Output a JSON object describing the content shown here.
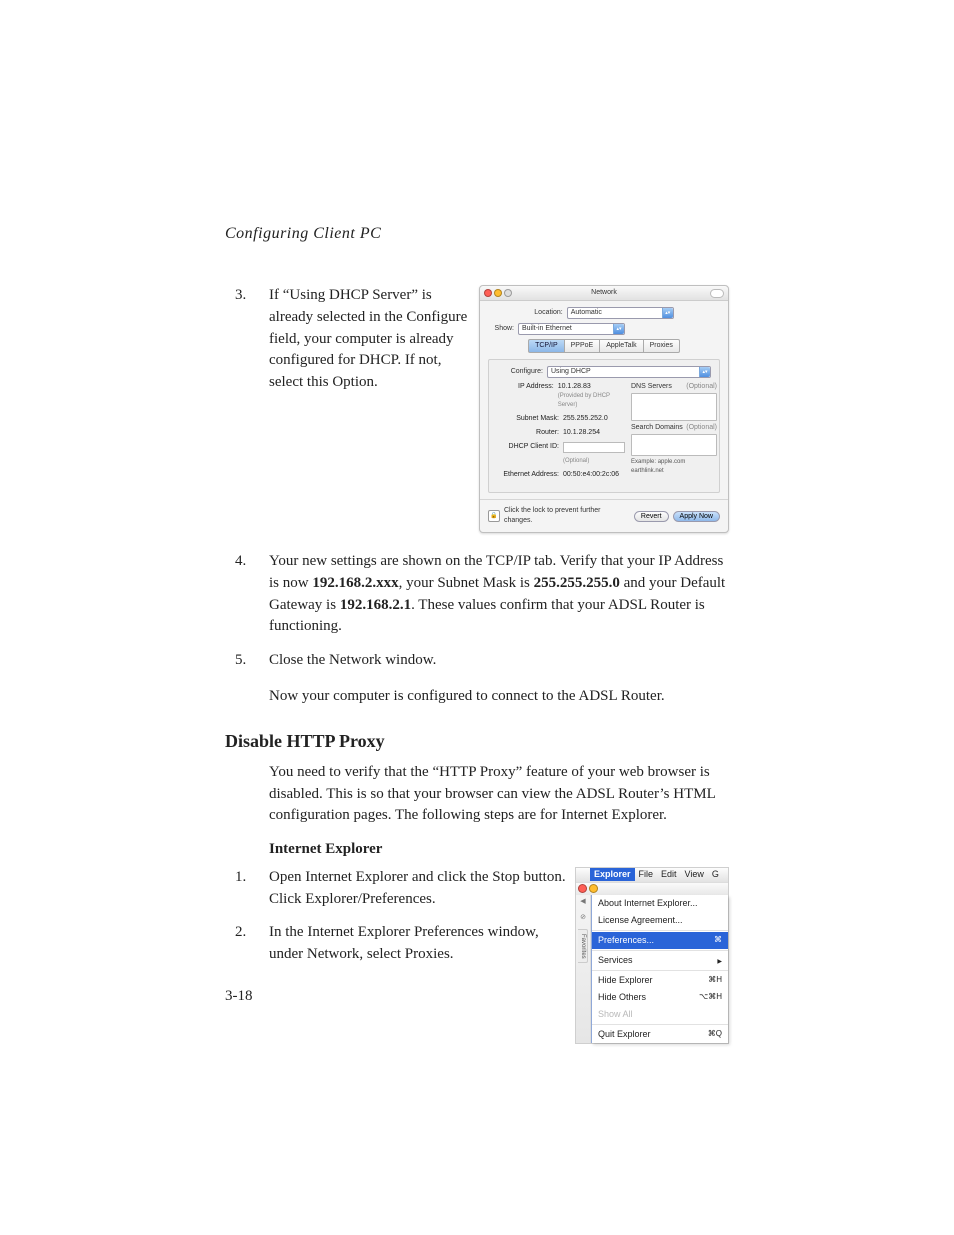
{
  "running_head": "Configuring Client PC",
  "steps_a": [
    {
      "n": "3.",
      "text": "If “Using DHCP Server” is already selected in the Configure field, your computer is already configured for DHCP. If not, select this Option."
    }
  ],
  "steps_b": [
    {
      "n": "4.",
      "pre": "Your new settings are shown on the TCP/IP tab. Verify that your IP Address is now ",
      "b1": "192.168.2.xxx",
      "mid1": ", your Subnet Mask is ",
      "b2": "255.255.255.0",
      "mid2": " and your Default Gateway is ",
      "b3": "192.168.2.1",
      "post": ". These values confirm that your ADSL Router is functioning."
    },
    {
      "n": "5.",
      "text": "Close the Network window."
    }
  ],
  "para1": "Now your computer is configured to connect to the ADSL Router.",
  "h2": "Disable HTTP Proxy",
  "para2": "You need to verify that the “HTTP Proxy” feature of your web browser is disabled. This is so that your browser can view the ADSL Router’s HTML configuration pages. The following steps are for Internet Explorer.",
  "h3": "Internet Explorer",
  "steps_c": [
    {
      "n": "1.",
      "text": "Open Internet Explorer and click the Stop button. Click Explorer/Preferences."
    },
    {
      "n": "2.",
      "text": "In the Internet Explorer Preferences window, under Network, select Proxies."
    }
  ],
  "page_number": "3-18",
  "network_panel": {
    "title": "Network",
    "location_label": "Location:",
    "location_value": "Automatic",
    "show_label": "Show:",
    "show_value": "Built-in Ethernet",
    "tabs": [
      "TCP/IP",
      "PPPoE",
      "AppleTalk",
      "Proxies"
    ],
    "configure_label": "Configure:",
    "configure_value": "Using DHCP",
    "ip_label": "IP Address:",
    "ip_value": "10.1.28.83",
    "ip_note": "(Provided by DHCP Server)",
    "subnet_label": "Subnet Mask:",
    "subnet_value": "255.255.252.0",
    "router_label": "Router:",
    "router_value": "10.1.28.254",
    "client_label": "DHCP Client ID:",
    "client_value": "",
    "client_note": "(Optional)",
    "eth_label": "Ethernet Address:",
    "eth_value": "00:50:e4:00:2c:06",
    "dns_label": "DNS Servers",
    "dns_opt": "(Optional)",
    "search_label": "Search Domains",
    "search_opt": "(Optional)",
    "example_label": "Example:",
    "example_value": "apple.com\nearthlink.net",
    "lock_msg": "Click the lock to prevent further changes.",
    "revert": "Revert",
    "apply": "Apply Now"
  },
  "explorer": {
    "menus": [
      "Explorer",
      "File",
      "Edit",
      "View",
      "G"
    ],
    "items": {
      "about": "About Internet Explorer...",
      "license": "License Agreement...",
      "prefs": "Preferences...",
      "prefs_sc": "⌘",
      "services": "Services",
      "hide_exp": "Hide Explorer",
      "hide_exp_sc": "⌘H",
      "hide_oth": "Hide Others",
      "hide_oth_sc": "⌥⌘H",
      "show_all": "Show All",
      "quit": "Quit Explorer",
      "quit_sc": "⌘Q"
    },
    "side_tab": "Favorites"
  }
}
